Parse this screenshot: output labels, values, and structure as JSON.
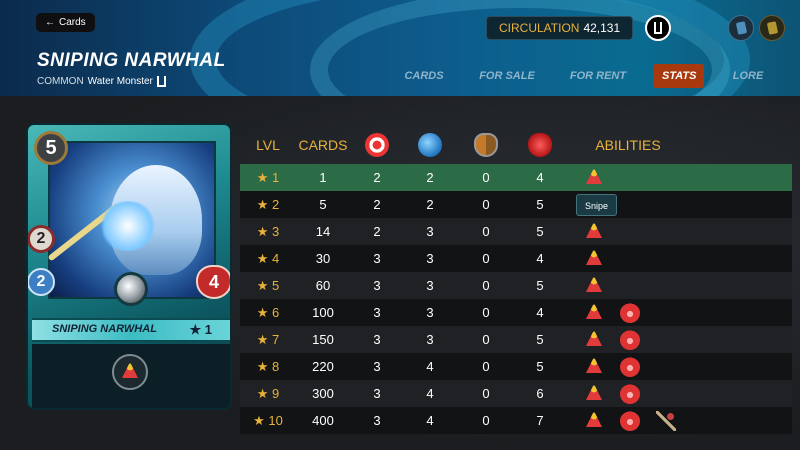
{
  "header": {
    "back_label": "Cards",
    "card_title": "SNIPING NARWHAL",
    "rarity": "COMMON",
    "type_label": "Water Monster",
    "circulation_label": "CIRCULATION",
    "circulation_value": "42,131"
  },
  "tabs": [
    {
      "label": "CARDS",
      "active": false
    },
    {
      "label": "FOR SALE",
      "active": false
    },
    {
      "label": "FOR RENT",
      "active": false
    },
    {
      "label": "STATS",
      "active": true
    },
    {
      "label": "LORE",
      "active": false
    }
  ],
  "card": {
    "mana": "5",
    "attack": "2",
    "magic": "2",
    "health": "4",
    "name": "SNIPING NARWHAL",
    "level_badge": "★ 1",
    "ability_icon": "snipe-icon"
  },
  "table": {
    "headers": {
      "lvl": "LVL",
      "cards": "CARDS",
      "abilities": "ABILITIES"
    },
    "stat_icons": [
      "speed-icon",
      "magic-icon",
      "armor-icon",
      "health-icon"
    ],
    "rows": [
      {
        "lvl": "★ 1",
        "cards": "1",
        "speed": "2",
        "magic": "2",
        "armor": "0",
        "health": "4",
        "abilities": [
          "snipe"
        ]
      },
      {
        "lvl": "★ 2",
        "cards": "5",
        "speed": "2",
        "magic": "2",
        "armor": "0",
        "health": "5",
        "abilities": []
      },
      {
        "lvl": "★ 3",
        "cards": "14",
        "speed": "2",
        "magic": "3",
        "armor": "0",
        "health": "5",
        "abilities": [
          "snipe"
        ]
      },
      {
        "lvl": "★ 4",
        "cards": "30",
        "speed": "3",
        "magic": "3",
        "armor": "0",
        "health": "4",
        "abilities": [
          "snipe"
        ]
      },
      {
        "lvl": "★ 5",
        "cards": "60",
        "speed": "3",
        "magic": "3",
        "armor": "0",
        "health": "5",
        "abilities": [
          "snipe"
        ]
      },
      {
        "lvl": "★ 6",
        "cards": "100",
        "speed": "3",
        "magic": "3",
        "armor": "0",
        "health": "4",
        "abilities": [
          "snipe",
          "enrage"
        ]
      },
      {
        "lvl": "★ 7",
        "cards": "150",
        "speed": "3",
        "magic": "3",
        "armor": "0",
        "health": "5",
        "abilities": [
          "snipe",
          "enrage"
        ]
      },
      {
        "lvl": "★ 8",
        "cards": "220",
        "speed": "3",
        "magic": "4",
        "armor": "0",
        "health": "5",
        "abilities": [
          "snipe",
          "enrage"
        ]
      },
      {
        "lvl": "★ 9",
        "cards": "300",
        "speed": "3",
        "magic": "4",
        "armor": "0",
        "health": "6",
        "abilities": [
          "snipe",
          "enrage"
        ]
      },
      {
        "lvl": "★ 10",
        "cards": "400",
        "speed": "3",
        "magic": "4",
        "armor": "0",
        "health": "7",
        "abilities": [
          "snipe",
          "enrage",
          "pierce"
        ]
      }
    ]
  },
  "tooltip": "Snipe",
  "colors": {
    "accent": "#e8b23c",
    "active_row": "#2b6b46",
    "active_tab": "#a8390e"
  }
}
